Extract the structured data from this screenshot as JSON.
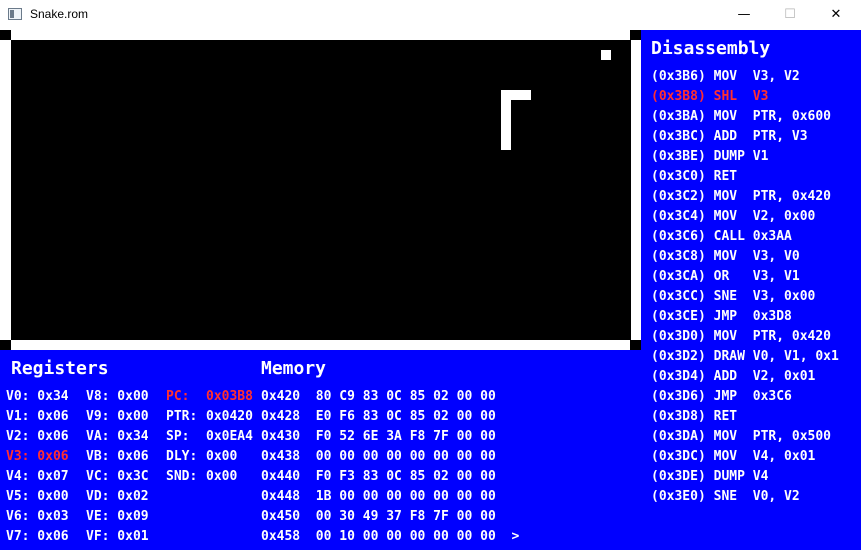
{
  "window": {
    "title": "Snake.rom",
    "minimize": "—",
    "maximize": "☐",
    "close": "✕"
  },
  "icons": {
    "app": "window-app-icon"
  },
  "colors": {
    "background": "#0000ff",
    "text": "#ffffff",
    "highlight": "#ff3030",
    "screen": "#000000",
    "frame": "#ffffff"
  },
  "disassembly": {
    "title": "Disassembly",
    "current_index": 1,
    "lines": [
      "(0x3B6) MOV  V3, V2",
      "(0x3B8) SHL  V3",
      "(0x3BA) MOV  PTR, 0x600",
      "(0x3BC) ADD  PTR, V3",
      "(0x3BE) DUMP V1",
      "(0x3C0) RET",
      "(0x3C2) MOV  PTR, 0x420",
      "(0x3C4) MOV  V2, 0x00",
      "(0x3C6) CALL 0x3AA",
      "(0x3C8) MOV  V3, V0",
      "(0x3CA) OR   V3, V1",
      "(0x3CC) SNE  V3, 0x00",
      "(0x3CE) JMP  0x3D8",
      "(0x3D0) MOV  PTR, 0x420",
      "(0x3D2) DRAW V0, V1, 0x1",
      "(0x3D4) ADD  V2, 0x01",
      "(0x3D6) JMP  0x3C6",
      "(0x3D8) RET",
      "(0x3DA) MOV  PTR, 0x500",
      "(0x3DC) MOV  V4, 0x01",
      "(0x3DE) DUMP V4",
      "(0x3E0) SNE  V0, V2"
    ]
  },
  "registers": {
    "title": "Registers",
    "col1": [
      "V0: 0x34",
      "V1: 0x06",
      "V2: 0x06",
      "V3: 0x06",
      "V4: 0x07",
      "V5: 0x00",
      "V6: 0x03",
      "V7: 0x06"
    ],
    "col2": [
      "V8: 0x00",
      "V9: 0x00",
      "VA: 0x34",
      "VB: 0x06",
      "VC: 0x3C",
      "VD: 0x02",
      "VE: 0x09",
      "VF: 0x01"
    ],
    "special_labels": [
      "PC:",
      "PTR:",
      "SP:",
      "DLY:",
      "SND:"
    ],
    "special_values": [
      "0x03B8",
      "0x0420",
      "0x0EA4",
      "0x00",
      "0x00"
    ],
    "highlight_col1_index": 3,
    "highlight_special_index": 0
  },
  "memory": {
    "title": "Memory",
    "rows": [
      "0x420  80 C9 83 0C 85 02 00 00",
      "0x428  E0 F6 83 0C 85 02 00 00",
      "0x430  F0 52 6E 3A F8 7F 00 00",
      "0x438  00 00 00 00 00 00 00 00",
      "0x440  F0 F3 83 0C 85 02 00 00",
      "0x448  1B 00 00 00 00 00 00 00",
      "0x450  00 30 49 37 F8 7F 00 00",
      "0x458  00 10 00 00 00 00 00 00  >"
    ]
  }
}
